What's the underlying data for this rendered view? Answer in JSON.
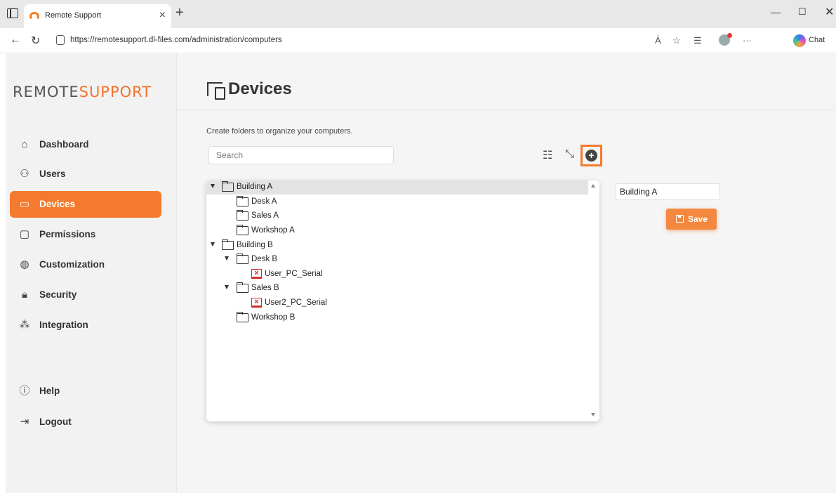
{
  "browser": {
    "tab_title": "Remote Support",
    "url": "https://remotesupport.dl-files.com/administration/computers",
    "chat_label": "Chat"
  },
  "logo": {
    "part1": "REMOTE",
    "part2": "SUPPORT"
  },
  "sidebar": {
    "items": [
      {
        "label": "Dashboard",
        "icon": "home-icon"
      },
      {
        "label": "Users",
        "icon": "users-icon"
      },
      {
        "label": "Devices",
        "icon": "devices-icon",
        "active": true
      },
      {
        "label": "Permissions",
        "icon": "folder-permissions-icon"
      },
      {
        "label": "Customization",
        "icon": "palette-icon"
      },
      {
        "label": "Security",
        "icon": "lock-icon"
      },
      {
        "label": "Integration",
        "icon": "network-icon"
      },
      {
        "label": "Help",
        "icon": "help-icon"
      },
      {
        "label": "Logout",
        "icon": "logout-icon"
      }
    ],
    "accent_color": "#f47a2e"
  },
  "page": {
    "title": "Devices",
    "description": "Create folders to organize your computers.",
    "search_placeholder": "Search"
  },
  "tree": [
    {
      "label": "Building A",
      "type": "folder",
      "expanded": true,
      "selected": true
    },
    {
      "label": "Desk A",
      "type": "folder"
    },
    {
      "label": "Sales A",
      "type": "folder"
    },
    {
      "label": "Workshop A",
      "type": "folder"
    },
    {
      "label": "Building B",
      "type": "folder",
      "expanded": true
    },
    {
      "label": "Desk B",
      "type": "folder",
      "expanded": true
    },
    {
      "label": "User_PC_Serial",
      "type": "computer",
      "status": "offline"
    },
    {
      "label": "Sales B",
      "type": "folder",
      "expanded": true
    },
    {
      "label": "User2_PC_Serial",
      "type": "computer",
      "status": "offline"
    },
    {
      "label": "Workshop B",
      "type": "folder"
    }
  ],
  "editor": {
    "name_value": "Building A",
    "save_label": "Save"
  }
}
